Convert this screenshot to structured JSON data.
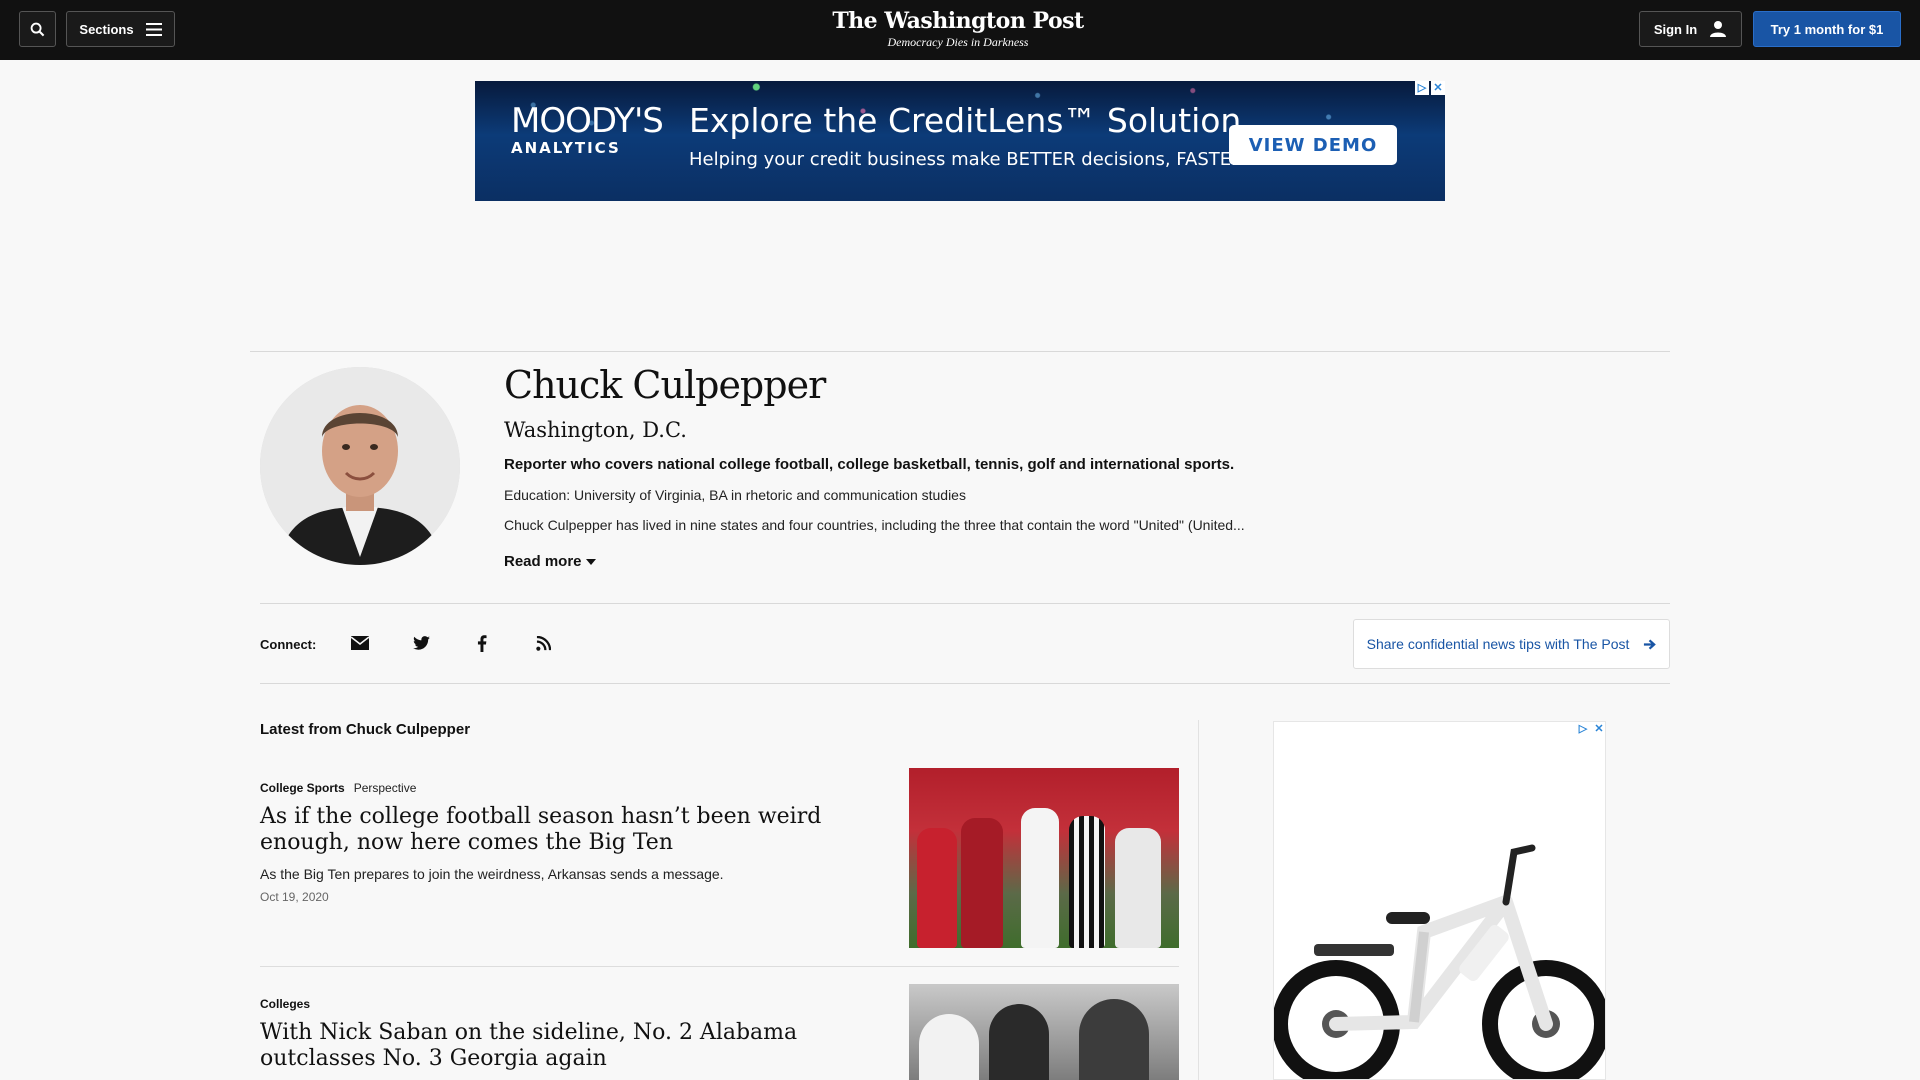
{
  "header": {
    "sections_label": "Sections",
    "logo_title": "The Washington Post",
    "logo_tagline": "Democracy Dies in Darkness",
    "signin_label": "Sign In",
    "subscribe_label": "Try 1 month for $1"
  },
  "banner_ad": {
    "brand": "MOODY'S",
    "brand_sub": "ANALYTICS",
    "headline": "Explore the CreditLens™ Solution",
    "subline": "Helping your credit business make BETTER decisions, FASTER",
    "cta": "VIEW DEMO"
  },
  "author": {
    "name": "Chuck Culpepper",
    "location": "Washington, D.C.",
    "role": "Reporter who covers national college football, college basketball, tennis, golf and international sports.",
    "education": "Education: University of Virginia, BA in rhetoric and communication studies",
    "bio": "Chuck Culpepper has lived in nine states and four countries, including the three that contain the word \"United\" (United...",
    "read_more": "Read more"
  },
  "connect": {
    "label": "Connect:",
    "icons": [
      "envelope-icon",
      "twitter-icon",
      "facebook-icon",
      "rss-icon"
    ],
    "tips_label": "Share confidential news tips with The Post"
  },
  "feed": {
    "heading": "Latest from Chuck Culpepper",
    "stories": [
      {
        "section": "College Sports",
        "label": "Perspective",
        "title": "As if the college football season hasn’t been weird enough, now here comes the Big Ten",
        "blurb": "As the Big Ten prepares to join the weirdness, Arkansas sends a message.",
        "date": "Oct 19, 2020"
      },
      {
        "section": "Colleges",
        "label": "",
        "title": "With Nick Saban on the sideline, No. 2 Alabama outclasses No. 3 Georgia again",
        "blurb": "",
        "date": ""
      }
    ]
  },
  "colors": {
    "topbar": "#111111",
    "accent": "#1955a5",
    "background": "#f8f8f8"
  }
}
